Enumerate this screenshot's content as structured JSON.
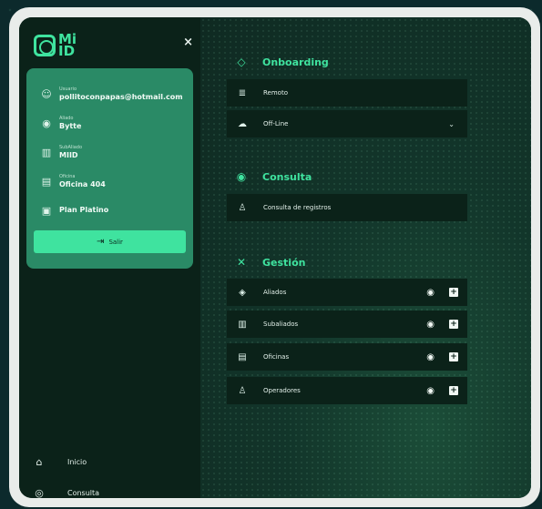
{
  "brand": {
    "logo_text": "Mi ID"
  },
  "sidebar": {
    "close_label": "×",
    "user_card": {
      "fields": [
        {
          "label": "Usuario",
          "value": "pollitoconpapas@hotmail.com",
          "icon": "user-circle-icon"
        },
        {
          "label": "Aliado",
          "value": "Bytte",
          "icon": "globe-icon"
        },
        {
          "label": "SubAliado",
          "value": "MIID",
          "icon": "building-icon"
        },
        {
          "label": "Oficina",
          "value": "Oficina 404",
          "icon": "store-icon"
        },
        {
          "label": "",
          "value": "Plan Platino",
          "icon": "card-icon"
        }
      ],
      "logout_label": "Salir"
    },
    "nav": [
      {
        "label": "Inicio",
        "icon": "home-icon"
      },
      {
        "label": "Consulta",
        "icon": "eye-icon"
      }
    ]
  },
  "main": {
    "sections": [
      {
        "title": "Onboarding",
        "icon": "tag-icon",
        "items": [
          {
            "label": "Remoto",
            "icon": "remote-icon"
          },
          {
            "label": "Off-Line",
            "icon": "cloud-off-icon",
            "has_dropdown": true
          }
        ]
      },
      {
        "title": "Consulta",
        "icon": "eye-icon",
        "items": [
          {
            "label": "Consulta de registros",
            "icon": "user-icon"
          }
        ]
      },
      {
        "title": "Gestión",
        "icon": "tools-icon",
        "items": [
          {
            "label": "Aliados",
            "icon": "badge-icon"
          },
          {
            "label": "Subaliados",
            "icon": "building-icon"
          },
          {
            "label": "Oficinas",
            "icon": "store-icon"
          },
          {
            "label": "Operadores",
            "icon": "user-icon"
          }
        ]
      }
    ]
  },
  "colors": {
    "accent": "#3fe39f",
    "card": "#2a8a66",
    "panel": "#0b2219"
  }
}
